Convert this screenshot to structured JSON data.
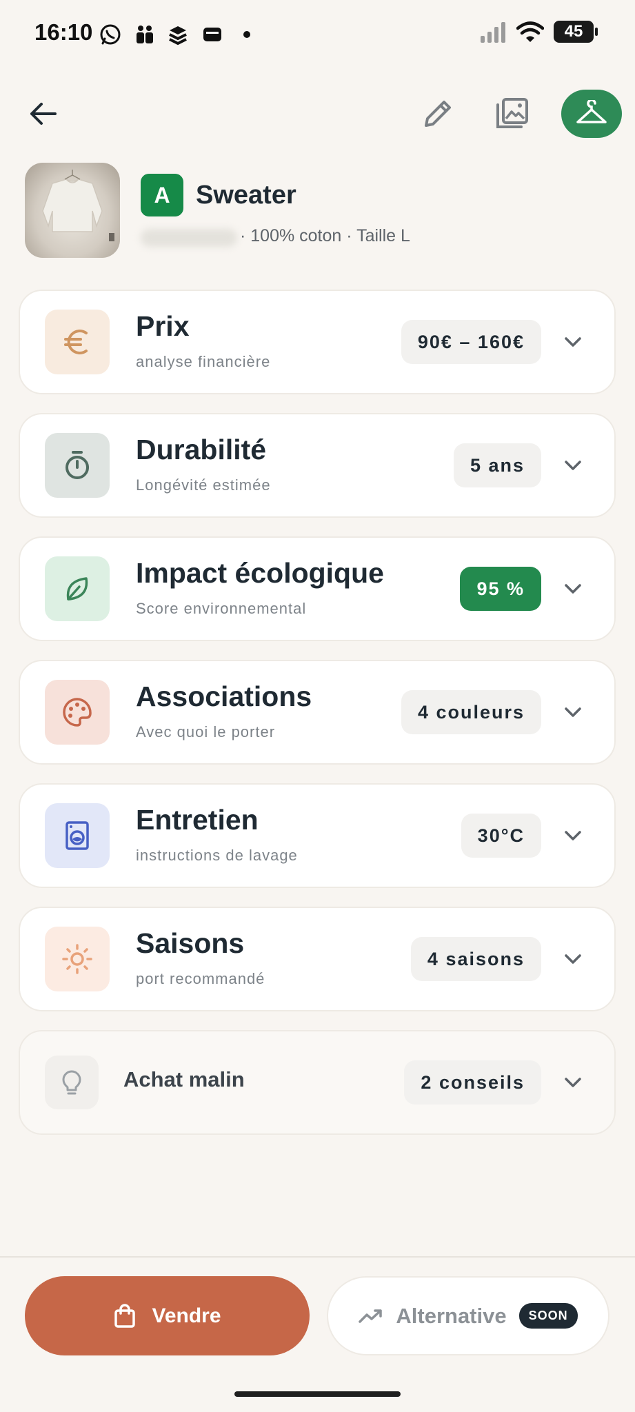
{
  "status_bar": {
    "time": "16:10",
    "battery": "45",
    "icons": [
      "whatsapp-icon",
      "teams-icon",
      "stack-icon",
      "wallet-icon",
      "dot-icon",
      "signal-icon",
      "wifi-icon",
      "battery-icon"
    ]
  },
  "top_bar": {
    "icons": [
      "back-arrow-icon",
      "pencil-icon",
      "gallery-icon",
      "hanger-icon"
    ],
    "accent": "#2E8B57"
  },
  "product": {
    "grade": "A",
    "name": "Sweater",
    "meta": "· 100% coton · Taille L"
  },
  "cards": [
    {
      "title": "Prix",
      "subtitle": "analyse financière",
      "value": "90€ – 160€",
      "icon": "euro-icon",
      "icon_bg": "#F8EBDF",
      "icon_color": "#CF9560"
    },
    {
      "title": "Durabilité",
      "subtitle": "Longévité estimée",
      "value": "5 ans",
      "icon": "timer-icon",
      "icon_bg": "#DFE4E1",
      "icon_color": "#4F6B60"
    },
    {
      "title": "Impact écologique",
      "subtitle": "Score environnemental",
      "value": "95 %",
      "icon": "leaf-icon",
      "icon_bg": "#DDF0E3",
      "icon_color": "#3B8559"
    },
    {
      "title": "Associations",
      "subtitle": "Avec quoi le porter",
      "value": "4 couleurs",
      "icon": "palette-icon",
      "icon_bg": "#F7E1DA",
      "icon_color": "#C6674B"
    },
    {
      "title": "Entretien",
      "subtitle": "instructions de lavage",
      "value": "30°C",
      "icon": "washing-machine-icon",
      "icon_bg": "#E2E7F8",
      "icon_color": "#4760C4"
    },
    {
      "title": "Saisons",
      "subtitle": "port recommandé",
      "value": "4 saisons",
      "icon": "sun-icon",
      "icon_bg": "#FCEBE2",
      "icon_color": "#E8A27A"
    }
  ],
  "tips_card": {
    "title": "Achat malin",
    "value": "2 conseils",
    "icon": "lightbulb-icon"
  },
  "bottom": {
    "sell_label": "Vendre",
    "alternative_label": "Alternative",
    "soon_label": "SOON",
    "sell_color": "#C66748"
  }
}
